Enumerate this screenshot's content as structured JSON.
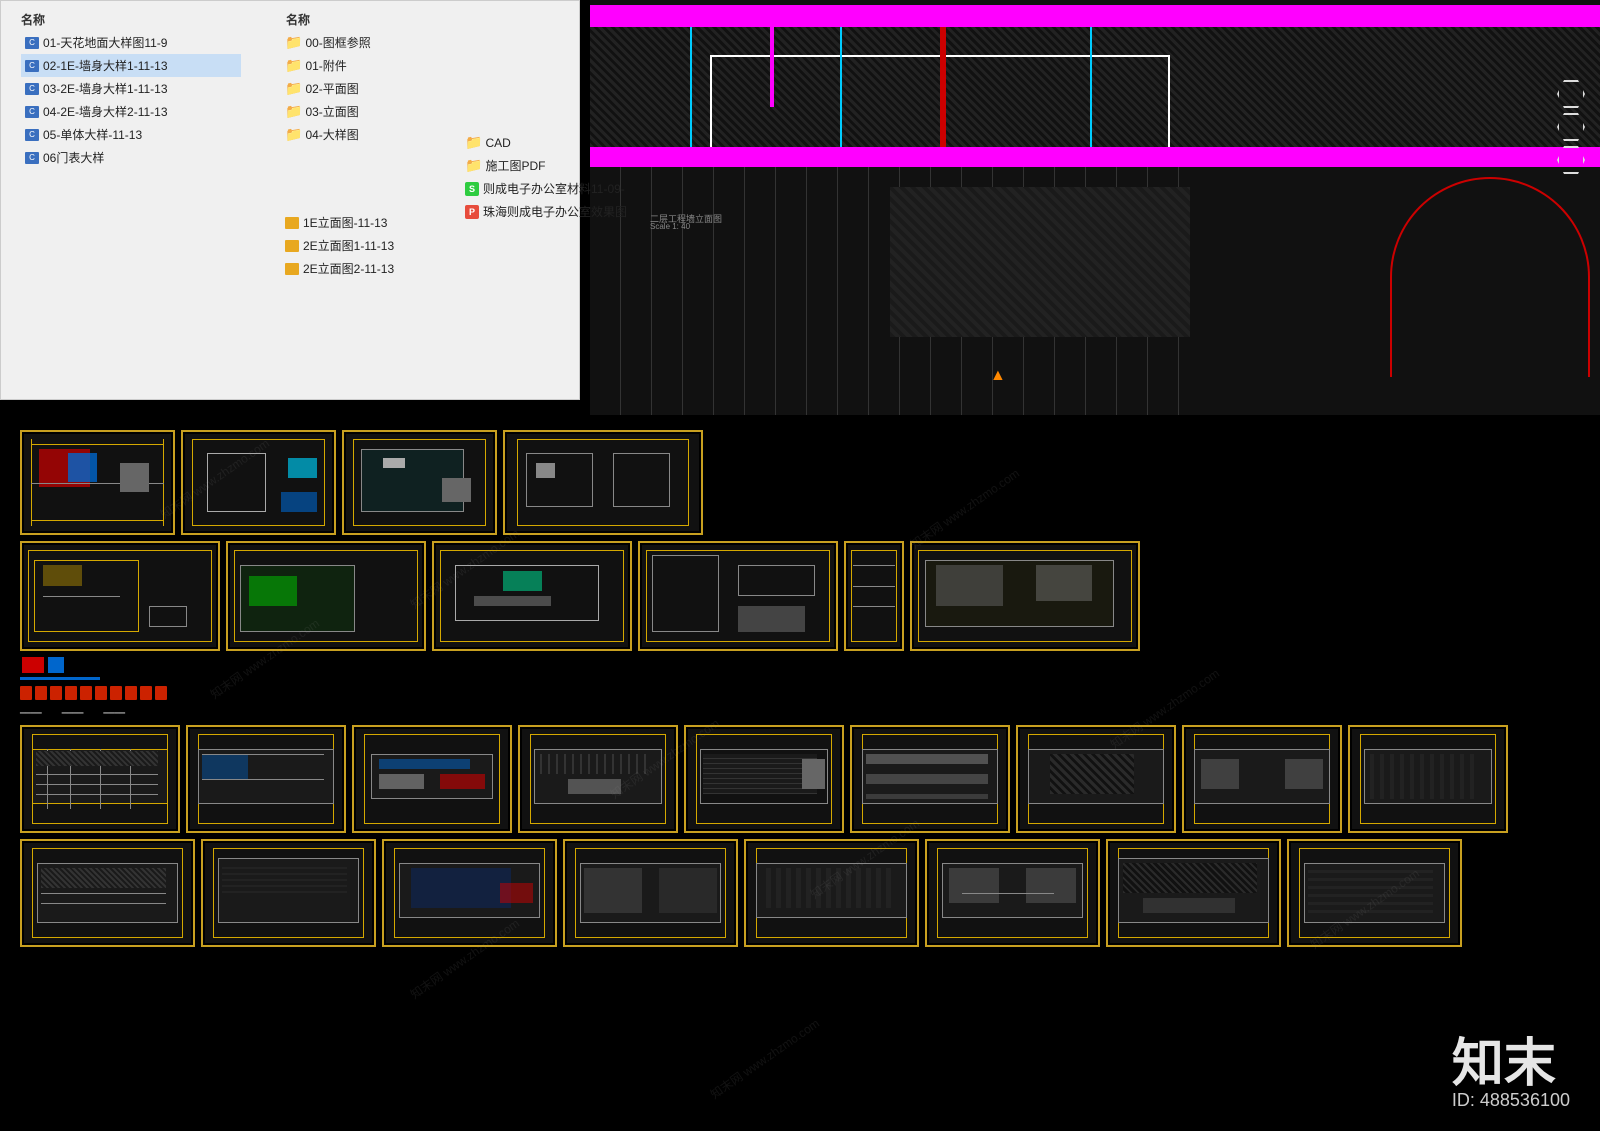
{
  "brand": {
    "chinese": "知末",
    "id_label": "ID: 488536100"
  },
  "file_explorer": {
    "header": "名称",
    "header2": "名称",
    "left_files": [
      {
        "name": "01-天花地面大样图11-9",
        "type": "cad",
        "selected": false
      },
      {
        "name": "02-1E-墙身大样1-11-13",
        "type": "cad",
        "selected": true
      },
      {
        "name": "03-2E-墙身大样1-11-13",
        "type": "cad",
        "selected": false
      },
      {
        "name": "04-2E-墙身大样2-11-13",
        "type": "cad",
        "selected": false
      },
      {
        "name": "05-单体大样-11-13",
        "type": "cad",
        "selected": false
      },
      {
        "name": "06门表大样",
        "type": "cad",
        "selected": false
      }
    ],
    "middle_folders": [
      {
        "name": "00-图框参照",
        "type": "folder"
      },
      {
        "name": "01-附件",
        "type": "folder"
      },
      {
        "name": "02-平面图",
        "type": "folder"
      },
      {
        "name": "03-立面图",
        "type": "folder"
      },
      {
        "name": "04-大样图",
        "type": "folder"
      }
    ],
    "subfiles": [
      {
        "name": "1E立面图-11-13",
        "type": "cad"
      },
      {
        "name": "2E立面图1-11-13",
        "type": "cad"
      },
      {
        "name": "2E立面图2-11-13",
        "type": "cad"
      }
    ],
    "right_items": [
      {
        "name": "CAD",
        "type": "folder"
      },
      {
        "name": "施工图PDF",
        "type": "folder"
      },
      {
        "name": "则成电子办公室材料11-09-",
        "type": "s_file"
      },
      {
        "name": "珠海则成电子办公室效果图",
        "type": "p_file"
      }
    ]
  },
  "watermarks": [
    "知末网 www.zhzmo.com",
    "知末网 www.zhzmo.com",
    "知末网 www.zhzmo.com",
    "知末网 www.zhzmo.com",
    "知末网 www.zhzmo.com",
    "知末网 www.zhzmo.com",
    "知末网 www.zhzmo.com",
    "知末网 www.zhzmo.com",
    "知末网 www.zhzmo.com",
    "知末网 www.zhzmo.com",
    "知末网 www.zhzmo.com",
    "知末网 www.zhzmo.com"
  ]
}
